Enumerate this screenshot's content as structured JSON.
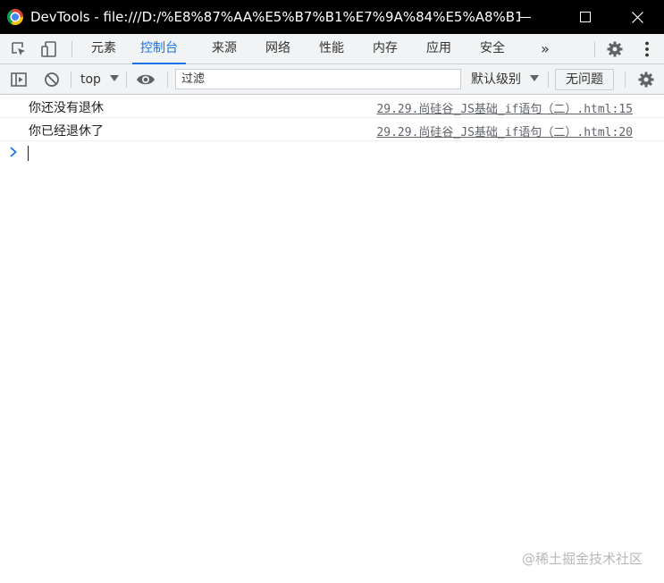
{
  "window": {
    "title": "DevTools - file:///D:/%E8%87%AA%E5%B7%B1%E7%9A%84%E5%A8%B1..."
  },
  "tabs": [
    {
      "label": "元素",
      "active": false
    },
    {
      "label": "控制台",
      "active": true
    },
    {
      "label": "来源",
      "active": false
    },
    {
      "label": "网络",
      "active": false
    },
    {
      "label": "性能",
      "active": false
    },
    {
      "label": "内存",
      "active": false
    },
    {
      "label": "应用",
      "active": false
    },
    {
      "label": "安全",
      "active": false
    }
  ],
  "tabbar": {
    "more_label": "»"
  },
  "toolbar": {
    "context": "top",
    "filter_placeholder": "过滤",
    "levels_label": "默认级别",
    "issues_label": "无问题"
  },
  "messages": [
    {
      "text": "你还没有退休",
      "source": "29.29.尚硅谷_JS基础_if语句（二）.html:15"
    },
    {
      "text": "你已经退休了",
      "source": "29.29.尚硅谷_JS基础_if语句（二）.html:20"
    }
  ],
  "watermark": "@稀土掘金技术社区",
  "icons": [
    "chrome-icon",
    "minimize-icon",
    "maximize-icon",
    "close-icon",
    "inspect-icon",
    "device-toggle-icon",
    "gear-icon",
    "kebab-menu-icon",
    "sidebar-toggle-icon",
    "clear-console-icon",
    "dropdown-arrow-icon",
    "eye-icon",
    "prompt-chevron-icon"
  ],
  "colors": {
    "accent": "#1a73e8",
    "titlebar": "#000000",
    "toolbar": "#f1f3f4"
  }
}
